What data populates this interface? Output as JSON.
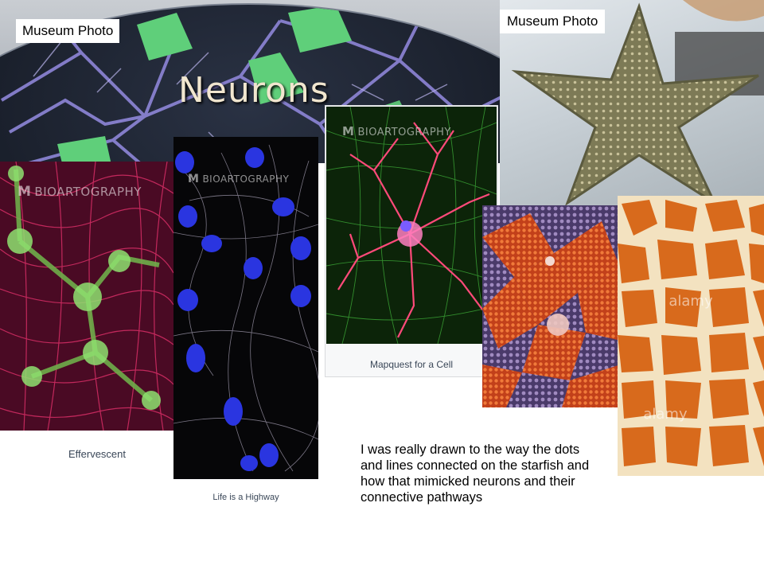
{
  "slide": {
    "museum_label_left": "Museum Photo",
    "museum_label_right": "Museum Photo",
    "neurons_sign_title": "Neurons",
    "watermark_brand": "BIOARTOGRAPHY",
    "captions": {
      "effervescent": "Effervescent",
      "highway": "Life is a Highway",
      "mapquest": "Mapquest for a Cell"
    },
    "description": "I was really drawn to the way the dots and lines connected on the starfish and how that mimicked neurons and their connective pathways",
    "stock_watermarks": [
      "alamy",
      "alamy"
    ]
  },
  "colors": {
    "neuron_green": "#5fcf7a",
    "neuron_lines": "#8e86d8",
    "effervescent_red": "#e0306a",
    "effervescent_green": "#8ee070",
    "highway_nuclei": "#2a35e0",
    "mapquest_green": "#3fb03a",
    "mapquest_red": "#ff4a7a",
    "starfish_orange": "#e06a1e"
  }
}
